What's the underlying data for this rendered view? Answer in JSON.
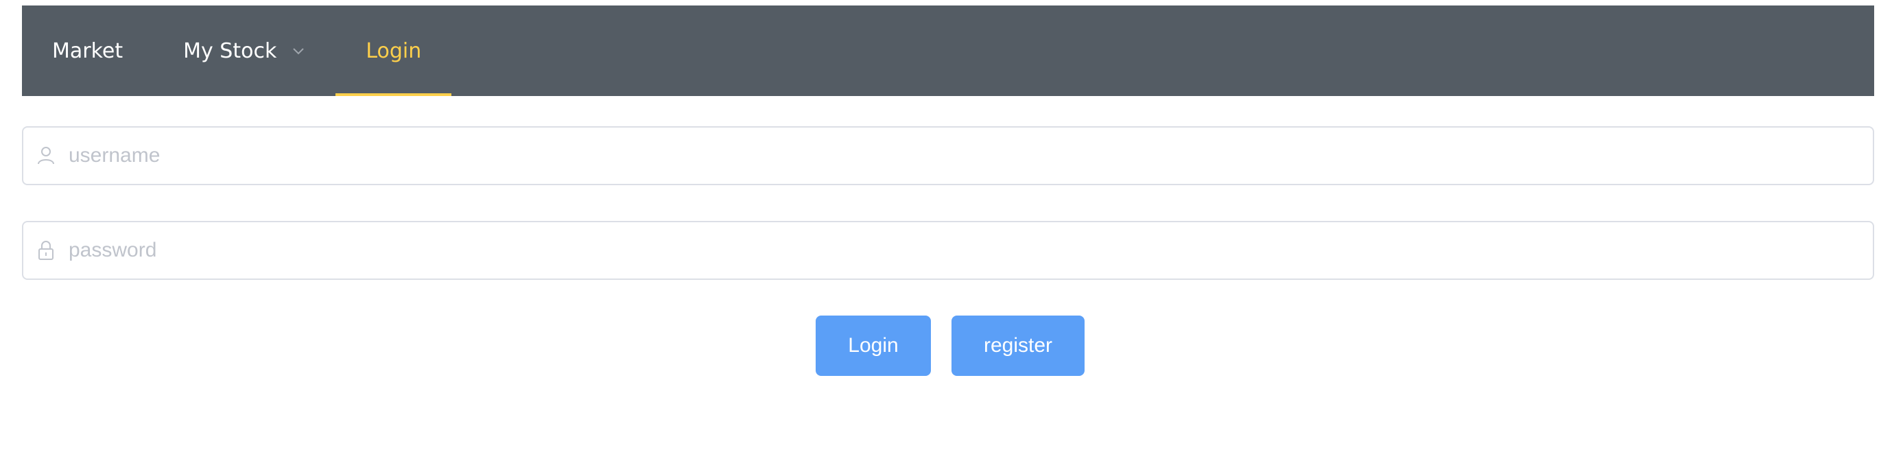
{
  "nav": {
    "items": [
      {
        "label": "Market",
        "active": false
      },
      {
        "label": "My Stock",
        "active": false,
        "has_dropdown": true
      },
      {
        "label": "Login",
        "active": true
      }
    ]
  },
  "form": {
    "username": {
      "placeholder": "username",
      "value": "",
      "icon": "user-icon"
    },
    "password": {
      "placeholder": "password",
      "value": "",
      "icon": "lock-icon"
    }
  },
  "buttons": {
    "login_label": "Login",
    "register_label": "register"
  },
  "colors": {
    "navbar_bg": "#545c64",
    "nav_active": "#ffd04b",
    "nav_text": "#ffffff",
    "button_bg": "#5b9ff7",
    "input_border": "#dcdfe6",
    "placeholder": "#c0c4cc"
  }
}
